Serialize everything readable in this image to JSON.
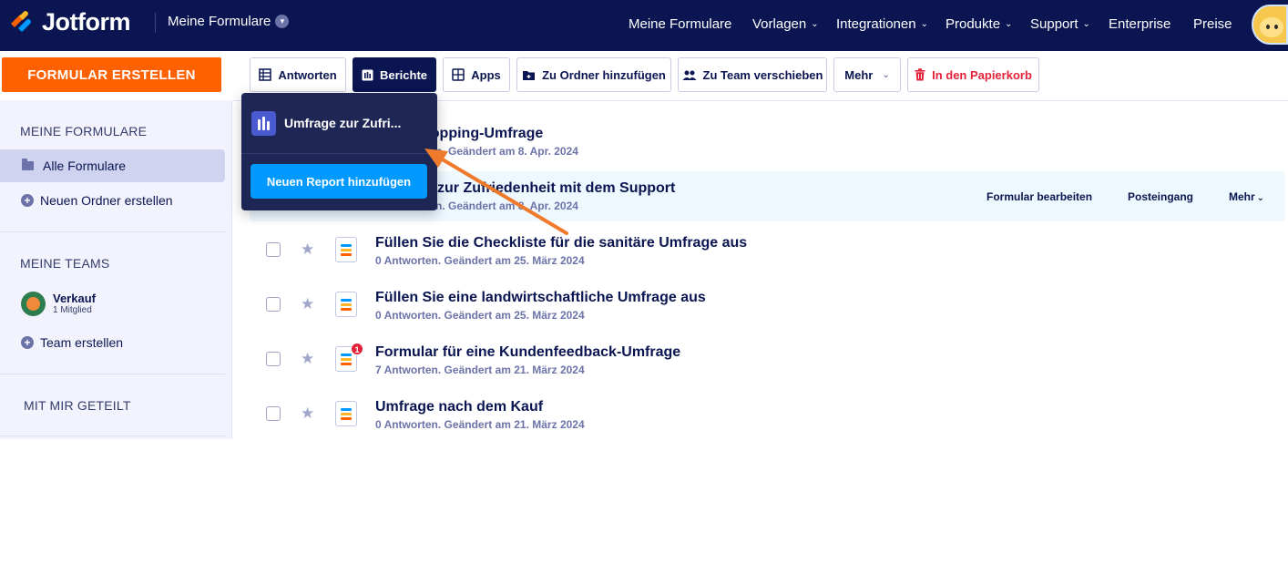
{
  "header": {
    "logo_text": "Jotform",
    "my_forms_label": "Meine Formulare",
    "nav": [
      {
        "label": "Meine Formulare",
        "caret": false
      },
      {
        "label": "Vorlagen",
        "caret": true
      },
      {
        "label": "Integrationen",
        "caret": true
      },
      {
        "label": "Produkte",
        "caret": true
      },
      {
        "label": "Support",
        "caret": true
      },
      {
        "label": "Enterprise",
        "caret": false
      },
      {
        "label": "Preise",
        "caret": false
      }
    ]
  },
  "sidebar": {
    "create_button": "FORMULAR ERSTELLEN",
    "my_forms_heading": "MEINE FORMULARE",
    "all_forms": "Alle Formulare",
    "new_folder": "Neuen Ordner erstellen",
    "my_teams_heading": "MEINE TEAMS",
    "team": {
      "name": "Verkauf",
      "members": "1 Mitglied"
    },
    "create_team": "Team erstellen",
    "shared_heading": "MIT MIR GETEILT"
  },
  "toolbar": {
    "responses": "Antworten",
    "reports": "Berichte",
    "apps": "Apps",
    "add_to_folder": "Zu Ordner hinzufügen",
    "move_to_team": "Zu Team verschieben",
    "more": "Mehr",
    "trash": "In den Papierkorb"
  },
  "dropdown": {
    "report_item": "Umfrage zur Zufri...",
    "add_report": "Neuen Report hinzufügen"
  },
  "forms": [
    {
      "title": "hopping-Umfrage",
      "meta": "n. Geändert am 8. Apr. 2024"
    },
    {
      "title": "zur Zufriedenheit mit dem Support",
      "meta": "n. Geändert am 8. Apr. 2024"
    },
    {
      "title": "Füllen Sie die Checkliste für die sanitäre Umfrage aus",
      "meta": "0 Antworten. Geändert am 25. März 2024"
    },
    {
      "title": "Füllen Sie eine landwirtschaftliche Umfrage aus",
      "meta": "0 Antworten. Geändert am 25. März 2024"
    },
    {
      "title": "Formular für eine Kundenfeedback-Umfrage",
      "meta": "7 Antworten. Geändert am 21. März 2024",
      "badge": "1"
    },
    {
      "title": "Umfrage nach dem Kauf",
      "meta": "0 Antworten. Geändert am 21. März 2024"
    }
  ],
  "row_actions": {
    "edit": "Formular bearbeiten",
    "inbox": "Posteingang",
    "more": "Mehr"
  },
  "colors": {
    "header_bg": "#0a1551",
    "accent_orange": "#ff6100",
    "accent_blue": "#0099ff",
    "danger": "#e3223a",
    "highlight_row": "#edf8ff"
  }
}
